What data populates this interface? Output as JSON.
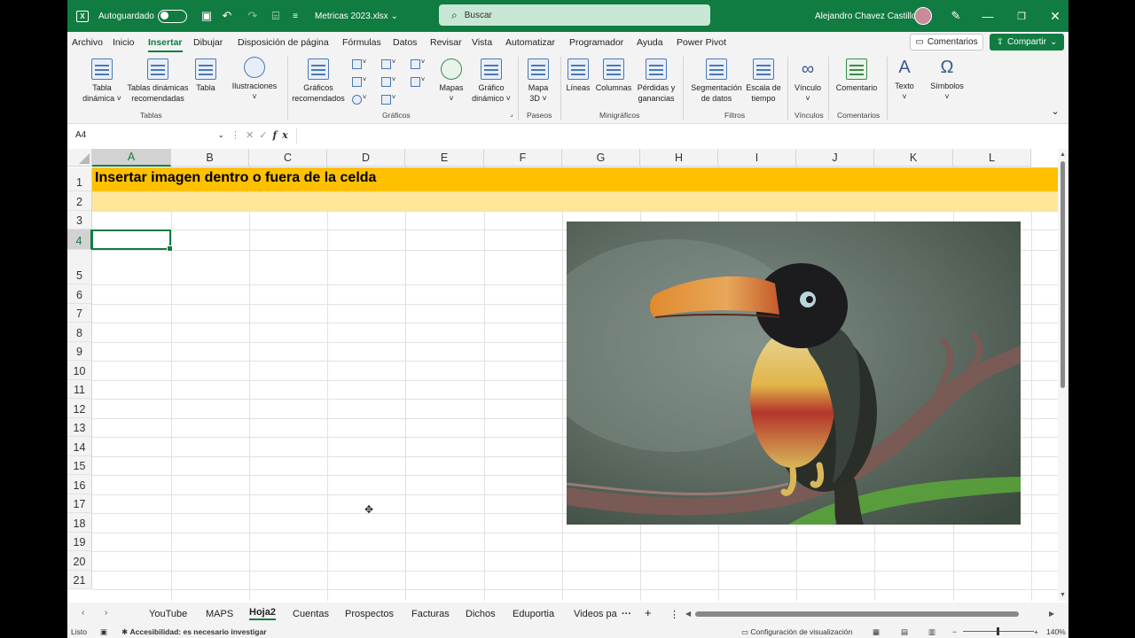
{
  "titlebar": {
    "autosave_label": "Autoguardado",
    "filename": "Metricas 2023.xlsx",
    "search_placeholder": "Buscar",
    "username": "Alejandro Chavez Castillo"
  },
  "menu": {
    "tabs": [
      "Archivo",
      "Inicio",
      "Insertar",
      "Dibujar",
      "Disposición de página",
      "Fórmulas",
      "Datos",
      "Revisar",
      "Vista",
      "Automatizar",
      "Programador",
      "Ayuda",
      "Power Pivot"
    ],
    "active_tab": "Insertar",
    "comments_label": "Comentarios",
    "share_label": "Compartir"
  },
  "ribbon": {
    "tabla_dinamica": [
      "Tabla",
      "dinámica ˅"
    ],
    "tablas_recomendadas": [
      "Tablas dinámicas",
      "recomendadas"
    ],
    "tabla": "Tabla",
    "ilustraciones": [
      "Ilustraciones",
      "˅"
    ],
    "graficos_recomendados": [
      "Gráficos",
      "recomendados"
    ],
    "mapas": [
      "Mapas",
      "˅"
    ],
    "grafico_dinamico": [
      "Gráfico",
      "dinámico ˅"
    ],
    "mapa3d": [
      "Mapa",
      "3D ˅"
    ],
    "lineas": "Líneas",
    "columnas": "Columnas",
    "perdidas": [
      "Pérdidas y",
      "ganancias"
    ],
    "segmentacion": [
      "Segmentación",
      "de datos"
    ],
    "escala": [
      "Escala de",
      "tiempo"
    ],
    "vinculo": [
      "Vínculo",
      "˅"
    ],
    "comentario": "Comentario",
    "texto": [
      "Texto",
      "˅"
    ],
    "simbolos": [
      "Símbolos",
      "˅"
    ],
    "groups": {
      "tablas": "Tablas",
      "graficos": "Gráficos",
      "paseos": "Paseos",
      "minigraficos": "Minigráficos",
      "filtros": "Filtros",
      "vinculos": "Vínculos",
      "comentarios": "Comentarios"
    }
  },
  "formula_bar": {
    "name_box": "A4",
    "formula": ""
  },
  "grid": {
    "columns": [
      "A",
      "B",
      "C",
      "D",
      "E",
      "F",
      "G",
      "H",
      "I",
      "J",
      "K",
      "L"
    ],
    "rows": [
      "1",
      "2",
      "3",
      "4",
      "5",
      "6",
      "7",
      "8",
      "9",
      "10",
      "11",
      "12",
      "13",
      "14",
      "15",
      "16",
      "17",
      "18",
      "19",
      "20",
      "21"
    ],
    "active_column": "A",
    "active_row": "4",
    "a1_text": "Insertar imagen dentro o fuera de la celda"
  },
  "sheets": {
    "tabs": [
      "YouTube",
      "MAPS",
      "Hoja2",
      "Cuentas",
      "Prospectos",
      "Facturas",
      "Dichos",
      "Eduportia",
      "Videos pa"
    ],
    "active": "Hoja2"
  },
  "status": {
    "ready": "Listo",
    "accessibility": "Accesibilidad: es necesario investigar",
    "display_settings": "Configuración de visualización",
    "zoom": "140%"
  },
  "colors": {
    "brand": "#107c41",
    "header_band": "#ffc000",
    "subheader_band": "#ffe699"
  }
}
